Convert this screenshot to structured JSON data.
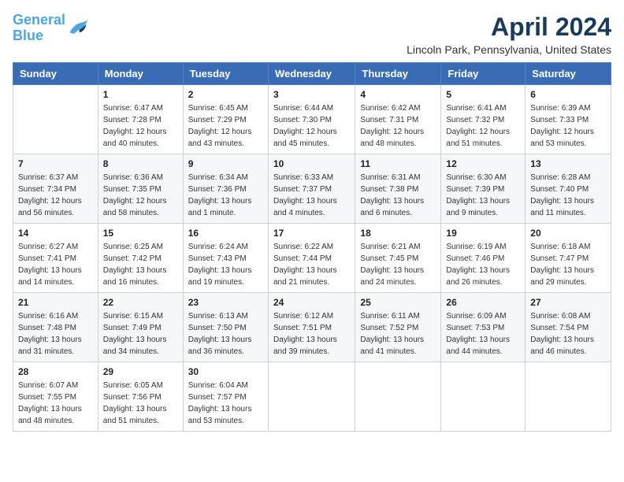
{
  "header": {
    "logo_line1": "General",
    "logo_line2": "Blue",
    "month_year": "April 2024",
    "location": "Lincoln Park, Pennsylvania, United States"
  },
  "days_of_week": [
    "Sunday",
    "Monday",
    "Tuesday",
    "Wednesday",
    "Thursday",
    "Friday",
    "Saturday"
  ],
  "weeks": [
    [
      {
        "day": "",
        "sunrise": "",
        "sunset": "",
        "daylight": ""
      },
      {
        "day": "1",
        "sunrise": "Sunrise: 6:47 AM",
        "sunset": "Sunset: 7:28 PM",
        "daylight": "Daylight: 12 hours and 40 minutes."
      },
      {
        "day": "2",
        "sunrise": "Sunrise: 6:45 AM",
        "sunset": "Sunset: 7:29 PM",
        "daylight": "Daylight: 12 hours and 43 minutes."
      },
      {
        "day": "3",
        "sunrise": "Sunrise: 6:44 AM",
        "sunset": "Sunset: 7:30 PM",
        "daylight": "Daylight: 12 hours and 45 minutes."
      },
      {
        "day": "4",
        "sunrise": "Sunrise: 6:42 AM",
        "sunset": "Sunset: 7:31 PM",
        "daylight": "Daylight: 12 hours and 48 minutes."
      },
      {
        "day": "5",
        "sunrise": "Sunrise: 6:41 AM",
        "sunset": "Sunset: 7:32 PM",
        "daylight": "Daylight: 12 hours and 51 minutes."
      },
      {
        "day": "6",
        "sunrise": "Sunrise: 6:39 AM",
        "sunset": "Sunset: 7:33 PM",
        "daylight": "Daylight: 12 hours and 53 minutes."
      }
    ],
    [
      {
        "day": "7",
        "sunrise": "Sunrise: 6:37 AM",
        "sunset": "Sunset: 7:34 PM",
        "daylight": "Daylight: 12 hours and 56 minutes."
      },
      {
        "day": "8",
        "sunrise": "Sunrise: 6:36 AM",
        "sunset": "Sunset: 7:35 PM",
        "daylight": "Daylight: 12 hours and 58 minutes."
      },
      {
        "day": "9",
        "sunrise": "Sunrise: 6:34 AM",
        "sunset": "Sunset: 7:36 PM",
        "daylight": "Daylight: 13 hours and 1 minute."
      },
      {
        "day": "10",
        "sunrise": "Sunrise: 6:33 AM",
        "sunset": "Sunset: 7:37 PM",
        "daylight": "Daylight: 13 hours and 4 minutes."
      },
      {
        "day": "11",
        "sunrise": "Sunrise: 6:31 AM",
        "sunset": "Sunset: 7:38 PM",
        "daylight": "Daylight: 13 hours and 6 minutes."
      },
      {
        "day": "12",
        "sunrise": "Sunrise: 6:30 AM",
        "sunset": "Sunset: 7:39 PM",
        "daylight": "Daylight: 13 hours and 9 minutes."
      },
      {
        "day": "13",
        "sunrise": "Sunrise: 6:28 AM",
        "sunset": "Sunset: 7:40 PM",
        "daylight": "Daylight: 13 hours and 11 minutes."
      }
    ],
    [
      {
        "day": "14",
        "sunrise": "Sunrise: 6:27 AM",
        "sunset": "Sunset: 7:41 PM",
        "daylight": "Daylight: 13 hours and 14 minutes."
      },
      {
        "day": "15",
        "sunrise": "Sunrise: 6:25 AM",
        "sunset": "Sunset: 7:42 PM",
        "daylight": "Daylight: 13 hours and 16 minutes."
      },
      {
        "day": "16",
        "sunrise": "Sunrise: 6:24 AM",
        "sunset": "Sunset: 7:43 PM",
        "daylight": "Daylight: 13 hours and 19 minutes."
      },
      {
        "day": "17",
        "sunrise": "Sunrise: 6:22 AM",
        "sunset": "Sunset: 7:44 PM",
        "daylight": "Daylight: 13 hours and 21 minutes."
      },
      {
        "day": "18",
        "sunrise": "Sunrise: 6:21 AM",
        "sunset": "Sunset: 7:45 PM",
        "daylight": "Daylight: 13 hours and 24 minutes."
      },
      {
        "day": "19",
        "sunrise": "Sunrise: 6:19 AM",
        "sunset": "Sunset: 7:46 PM",
        "daylight": "Daylight: 13 hours and 26 minutes."
      },
      {
        "day": "20",
        "sunrise": "Sunrise: 6:18 AM",
        "sunset": "Sunset: 7:47 PM",
        "daylight": "Daylight: 13 hours and 29 minutes."
      }
    ],
    [
      {
        "day": "21",
        "sunrise": "Sunrise: 6:16 AM",
        "sunset": "Sunset: 7:48 PM",
        "daylight": "Daylight: 13 hours and 31 minutes."
      },
      {
        "day": "22",
        "sunrise": "Sunrise: 6:15 AM",
        "sunset": "Sunset: 7:49 PM",
        "daylight": "Daylight: 13 hours and 34 minutes."
      },
      {
        "day": "23",
        "sunrise": "Sunrise: 6:13 AM",
        "sunset": "Sunset: 7:50 PM",
        "daylight": "Daylight: 13 hours and 36 minutes."
      },
      {
        "day": "24",
        "sunrise": "Sunrise: 6:12 AM",
        "sunset": "Sunset: 7:51 PM",
        "daylight": "Daylight: 13 hours and 39 minutes."
      },
      {
        "day": "25",
        "sunrise": "Sunrise: 6:11 AM",
        "sunset": "Sunset: 7:52 PM",
        "daylight": "Daylight: 13 hours and 41 minutes."
      },
      {
        "day": "26",
        "sunrise": "Sunrise: 6:09 AM",
        "sunset": "Sunset: 7:53 PM",
        "daylight": "Daylight: 13 hours and 44 minutes."
      },
      {
        "day": "27",
        "sunrise": "Sunrise: 6:08 AM",
        "sunset": "Sunset: 7:54 PM",
        "daylight": "Daylight: 13 hours and 46 minutes."
      }
    ],
    [
      {
        "day": "28",
        "sunrise": "Sunrise: 6:07 AM",
        "sunset": "Sunset: 7:55 PM",
        "daylight": "Daylight: 13 hours and 48 minutes."
      },
      {
        "day": "29",
        "sunrise": "Sunrise: 6:05 AM",
        "sunset": "Sunset: 7:56 PM",
        "daylight": "Daylight: 13 hours and 51 minutes."
      },
      {
        "day": "30",
        "sunrise": "Sunrise: 6:04 AM",
        "sunset": "Sunset: 7:57 PM",
        "daylight": "Daylight: 13 hours and 53 minutes."
      },
      {
        "day": "",
        "sunrise": "",
        "sunset": "",
        "daylight": ""
      },
      {
        "day": "",
        "sunrise": "",
        "sunset": "",
        "daylight": ""
      },
      {
        "day": "",
        "sunrise": "",
        "sunset": "",
        "daylight": ""
      },
      {
        "day": "",
        "sunrise": "",
        "sunset": "",
        "daylight": ""
      }
    ]
  ]
}
